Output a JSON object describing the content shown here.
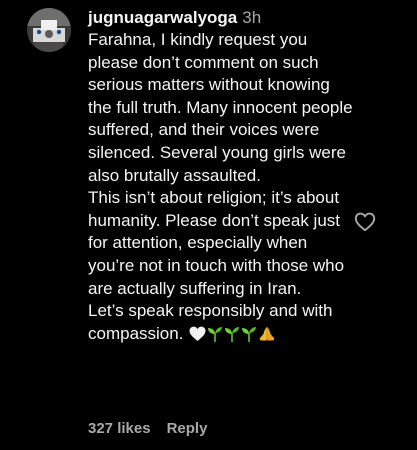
{
  "comment": {
    "username": "jugnuagarwalyoga",
    "timestamp": "3h",
    "text": "Farahna, I kindly request you please don’t comment on such serious matters without knowing the full truth. Many innocent people suffered, and their voices were silenced. Several young girls were also brutally assaulted.\nThis isn’t about religion; it’s about humanity. Please don’t speak just for attention, especially when you’re not in touch with those who are actually suffering in Iran.\nLet’s speak responsibly and with compassion.",
    "emojis": [
      "white-heart-icon",
      "seedling-icon",
      "seedling-icon",
      "seedling-icon",
      "folded-hands-icon"
    ],
    "likes_label": "327 likes",
    "reply_label": "Reply"
  },
  "colors": {
    "background": "#000000",
    "primary_text": "#f5f5f5",
    "secondary_text": "#a8a8a8"
  }
}
